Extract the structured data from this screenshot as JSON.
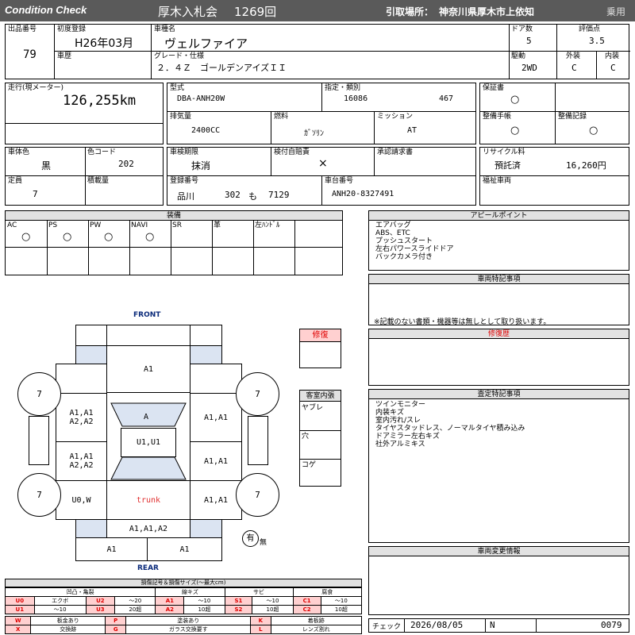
{
  "header": {
    "title_en": "Condition  Check",
    "auction": "厚木入札会",
    "session": "1269回",
    "pickup_label": "引取場所：",
    "pickup": "神奈川県厚木市上依知",
    "category": "乗用"
  },
  "row1": {
    "lot_label": "出品番号",
    "lot": "79",
    "first_reg_label": "初度登録",
    "first_reg": "H26年03月",
    "car_name_label": "車種名",
    "car_name": "ヴェルファイア",
    "doors_label": "ドア数",
    "doors": "5",
    "score_label": "評価点",
    "score": "3.5",
    "history_label": "車歴",
    "grade_label": "グレード・仕様",
    "grade": "２．４Ｚ　ゴールデンアイズＩＩ",
    "drive_label": "駆動",
    "drive": "2WD",
    "exterior_label": "外装",
    "exterior": "C",
    "interior_label": "内装",
    "interior": "C"
  },
  "row2": {
    "mileage_label": "走行(現メーター)",
    "mileage": "126,255km",
    "model_label": "型式",
    "model": "DBA-ANH20W",
    "designation_label": "指定・類別",
    "designation": "16086",
    "classification": "467",
    "warranty_label": "保証書",
    "warranty": "○",
    "displacement_label": "排気量",
    "displacement": "2400CC",
    "fuel_label": "燃料",
    "fuel": "ｶﾞｿﾘﾝ",
    "transmission_label": "ミッション",
    "transmission": "AT",
    "maint_book_label": "整備手帳",
    "maint_book": "○",
    "maint_record_label": "整備記録",
    "maint_record": "○"
  },
  "row3": {
    "body_color_label": "車体色",
    "body_color": "黒",
    "color_code_label": "色コード",
    "color_code": "202",
    "inspection_label": "車検期限",
    "inspection": "抹消",
    "certificate_label": "検付自賠責",
    "certificate": "×",
    "approval_label": "承認請求書",
    "recycle_label": "リサイクル料",
    "recycle_status": "預託済",
    "recycle_fee": "16,260円",
    "capacity_label": "定員",
    "capacity": "7",
    "load_label": "積載量",
    "reg_num_label": "登録番号",
    "reg_area": "品川",
    "reg_class": "302",
    "reg_kana": "も",
    "reg_number": "7129",
    "chassis_label": "車台番号",
    "chassis": "ANH20-8327491",
    "welfare_label": "福祉車両"
  },
  "equipment": {
    "title": "装備",
    "items": [
      {
        "label": "AC",
        "value": "○"
      },
      {
        "label": "PS",
        "value": "○"
      },
      {
        "label": "PW",
        "value": "○"
      },
      {
        "label": "NAVI",
        "value": "○"
      },
      {
        "label": "SR",
        "value": ""
      },
      {
        "label": "革",
        "value": ""
      },
      {
        "label": "左ﾊﾝﾄﾞﾙ",
        "value": ""
      }
    ]
  },
  "appeal": {
    "title": "アピールポイント",
    "lines": [
      "エアバッグ",
      "ABS、ETC",
      "プッシュスタート",
      "左右パワースライドドア",
      "バックカメラ付き"
    ]
  },
  "special_notes": {
    "title": "車両特記事項",
    "note": "※記載のない書類・機器等は無しとして取り扱います。"
  },
  "repair_history": {
    "title": "修復歴",
    "box_label": "修復"
  },
  "inspector_notes": {
    "title": "査定特記事項",
    "lines": [
      "ツインモニター",
      "内装キズ",
      "室内汚れ/スレ",
      "タイヤスタッドレス、ノーマルタイヤ積み込み",
      "ドアミラー左右キズ",
      "社外アルミキス"
    ]
  },
  "changes": {
    "title": "車両変更情報"
  },
  "cabin": {
    "title": "客室内張",
    "items": [
      "ヤブレ",
      "穴",
      "コゲ"
    ]
  },
  "diagram": {
    "front": "FRONT",
    "rear": "REAR",
    "trunk": "trunk",
    "tires": [
      "7",
      "7",
      "7",
      "7"
    ],
    "hood": "A1",
    "windshield": "A",
    "roof": "U1,U1",
    "front_left_door": "A1,A1\nA2,A2",
    "rear_left_door": "A1,A1\nA2,A2",
    "front_right_door": "A1,A1",
    "rear_right_door": "A1,A1",
    "left_quarter": "U0,W",
    "right_quarter": "A1,A1",
    "rear_gate": "A1,A1,A2",
    "rear_bumper_left": "A1",
    "rear_bumper_right": "A1",
    "spare_tire_icon": "有",
    "spare_tire_none": "無"
  },
  "legend": {
    "title": "損傷記号＆損傷サイズ(〜最大cm)",
    "groups": [
      "凹凸・亀裂",
      "線キズ",
      "サビ",
      "腐食"
    ],
    "row1": [
      [
        "U0",
        "エクボ"
      ],
      [
        "U2",
        "〜20"
      ],
      [
        "A1",
        "〜10"
      ],
      [
        "S1",
        "〜10"
      ],
      [
        "C1",
        "〜10"
      ]
    ],
    "row2": [
      [
        "U1",
        "〜10"
      ],
      [
        "U3",
        "20超"
      ],
      [
        "A2",
        "10超"
      ],
      [
        "S2",
        "10超"
      ],
      [
        "C2",
        "10超"
      ]
    ],
    "row3": [
      [
        "W",
        "板金あり"
      ],
      [
        "P",
        "塗装あり"
      ],
      [
        "K",
        "着板跡"
      ]
    ],
    "row4": [
      [
        "X",
        "交換跡"
      ],
      [
        "G",
        "ガラス交換要す"
      ],
      [
        "L",
        "レンズ割れ"
      ]
    ]
  },
  "footer": {
    "check_label": "チェック",
    "date": "2026/08/05",
    "code": "N",
    "number": "0079"
  }
}
